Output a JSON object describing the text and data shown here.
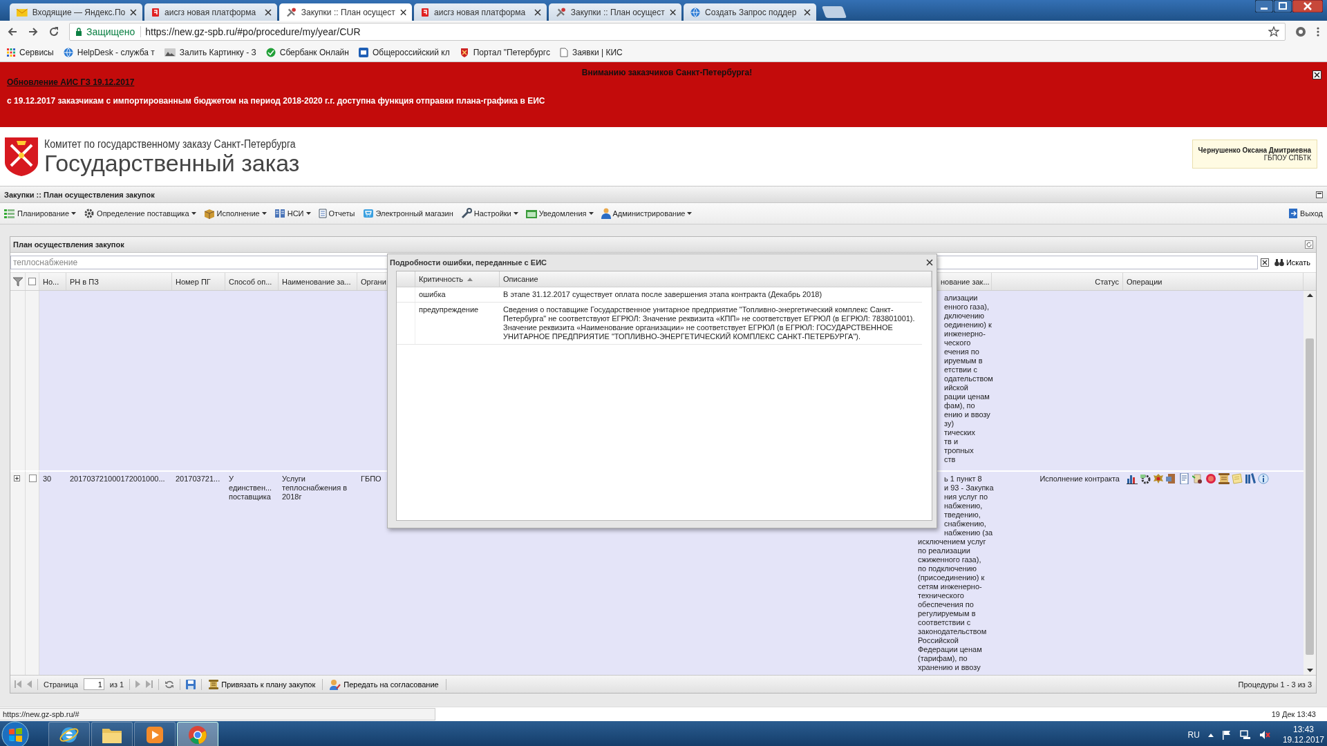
{
  "browser": {
    "tabs": [
      {
        "title": "Входящие — Яндекс.По",
        "kind": "mail",
        "selected": false
      },
      {
        "title": "аисгз новая платформа",
        "kind": "site",
        "selected": false
      },
      {
        "title": "Закупки :: План осущест",
        "kind": "app",
        "selected": true
      },
      {
        "title": "аисгз новая платформа",
        "kind": "site",
        "selected": false
      },
      {
        "title": "Закупки :: План осущест",
        "kind": "app",
        "selected": false
      },
      {
        "title": "Создать Запрос поддер",
        "kind": "globe",
        "selected": false
      }
    ],
    "address": {
      "security": "Защищено",
      "url": "https://new.gz-spb.ru/#po/procedure/my/year/CUR"
    },
    "bookmarks": [
      {
        "label": "Сервисы",
        "kind": "apps"
      },
      {
        "label": "HelpDesk - служба т",
        "kind": "globe"
      },
      {
        "label": "Залить Картинку - З",
        "kind": "image"
      },
      {
        "label": "Сбербанк Онлайн",
        "kind": "round"
      },
      {
        "label": "Общероссийский кл",
        "kind": "square"
      },
      {
        "label": "Портал \"Петербургс",
        "kind": "emblem"
      },
      {
        "label": "Заявки | КИС",
        "kind": "doc"
      }
    ]
  },
  "banner": {
    "title": "Вниманию заказчиков Санкт-Петербурга!",
    "link": "Обновление АИС ГЗ 19.12.2017",
    "message": "с 19.12.2017 заказчикам с импортированным бюджетом на период 2018-2020 г.г.  доступна функция отправки плана-графика  в ЕИС"
  },
  "header": {
    "org": "Комитет по государственному заказу Санкт-Петербурга",
    "title": "Государственный заказ",
    "user": {
      "name": "Чернушенко Оксана Дмитриевна",
      "org": "ГБПОУ СПБТК"
    }
  },
  "app_title": "Закупки :: План осуществления закупок",
  "menu": {
    "items": [
      {
        "label": "Планирование",
        "kind": "plan",
        "dropdown": true
      },
      {
        "label": "Определение поставщика",
        "kind": "supplier",
        "dropdown": true
      },
      {
        "label": "Исполнение",
        "kind": "exec",
        "dropdown": true
      },
      {
        "label": "НСИ",
        "kind": "nsi",
        "dropdown": true
      },
      {
        "label": "Отчеты",
        "kind": "reports",
        "dropdown": false
      },
      {
        "label": "Электронный магазин",
        "kind": "shop",
        "dropdown": false
      },
      {
        "label": "Настройки",
        "kind": "settings",
        "dropdown": true
      },
      {
        "label": "Уведомления",
        "kind": "notify",
        "dropdown": true
      },
      {
        "label": "Администрирование",
        "kind": "admin",
        "dropdown": true
      }
    ],
    "logout": "Выход"
  },
  "panel": {
    "title": "План осуществления закупок",
    "search": {
      "placeholder": "теплоснабжение",
      "button": "Искать"
    },
    "grid": {
      "select_all": {
        "checked": false
      },
      "columns": [
        "Но...",
        "РН в ПЗ",
        "Номер ПГ",
        "Способ оп...",
        "Наименование за...",
        "Органи",
        "нование зак...",
        "Статус",
        "Операции"
      ],
      "rows": [
        {
          "object_partial_lines": [
            "ализации",
            "енного газа),",
            "дключению",
            "оединению) к",
            "инженерно-",
            "ческого",
            "ечения по",
            "ируемым в",
            "етствии с",
            "одательством",
            "ийской",
            "рации ценам",
            "фам), по",
            "ению и ввозу",
            "зу)",
            "тических",
            "тв и",
            "тропных",
            "ств"
          ]
        },
        {
          "expanded": false,
          "checked": false,
          "number": "30",
          "rn": "201703721000172001000...",
          "pg": "201703721...",
          "method": "У единствен... поставщика",
          "name": "Услуги теплоснабжения в 2018г",
          "organizer": "ГБПО",
          "object_partial_lines": [
            "ь 1 пункт 8",
            "и 93 - Закупка",
            "ния услуг по",
            "набжению,",
            "тведению,",
            "снабжению,",
            "набжению (за"
          ],
          "object_lines": [
            "исключением услуг",
            "по реализации",
            "сжиженного газа),",
            "по подключению",
            "(присоединению) к",
            "сетям инженерно-",
            "технического",
            "обеспечения по",
            "регулируемым в",
            "соответствии с",
            "законодательством",
            "Российской",
            "Федерации ценам",
            "(тарифам), по",
            "хранению и ввозу"
          ],
          "status": "Исполнение контракта"
        }
      ]
    },
    "pager": {
      "page_label": "Страница",
      "page": "1",
      "of": "из 1",
      "buttons": [
        {
          "label": "Привязать к плану закупок",
          "kind": "attach"
        },
        {
          "label": "Передать на согласование",
          "kind": "send"
        }
      ],
      "summary": "Процедуры 1 - 3 из 3"
    }
  },
  "dialog": {
    "title": "Подробности ошибки, переданные с ЕИС",
    "columns": [
      "Критичность",
      "Описание"
    ],
    "rows": [
      {
        "severity": "ошибка",
        "description": "В этапе 31.12.2017 существует оплата после завершения этапа контракта (Декабрь 2018)"
      },
      {
        "severity": "предупреждение",
        "description": "Сведения о поставщике Государственное унитарное предприятие \"Топливно-энергетический комплекс Санкт-Петербурга\" не соответствуют ЕГРЮЛ: Значение реквизита «КПП» не соответствует ЕГРЮЛ (в ЕГРЮЛ: 783801001). Значение реквизита «Наименование организации» не соответствует ЕГРЮЛ (в ЕГРЮЛ: ГОСУДАРСТВЕННОЕ УНИТАРНОЕ ПРЕДПРИЯТИЕ \"ТОПЛИВНО-ЭНЕРГЕТИЧЕСКИЙ КОМПЛЕКС САНКТ-ПЕТЕРБУРГА\")."
      }
    ]
  },
  "status_bar": {
    "url": "https://new.gz-spb.ru/#",
    "datetime": "19 Дек 13:43"
  },
  "taskbar": {
    "apps": [
      {
        "kind": "ie",
        "selected": false
      },
      {
        "kind": "folder",
        "selected": false
      },
      {
        "kind": "media",
        "selected": false
      },
      {
        "kind": "chrome",
        "selected": true
      }
    ],
    "language": "RU",
    "time": "13:43",
    "date": "19.12.2017"
  }
}
